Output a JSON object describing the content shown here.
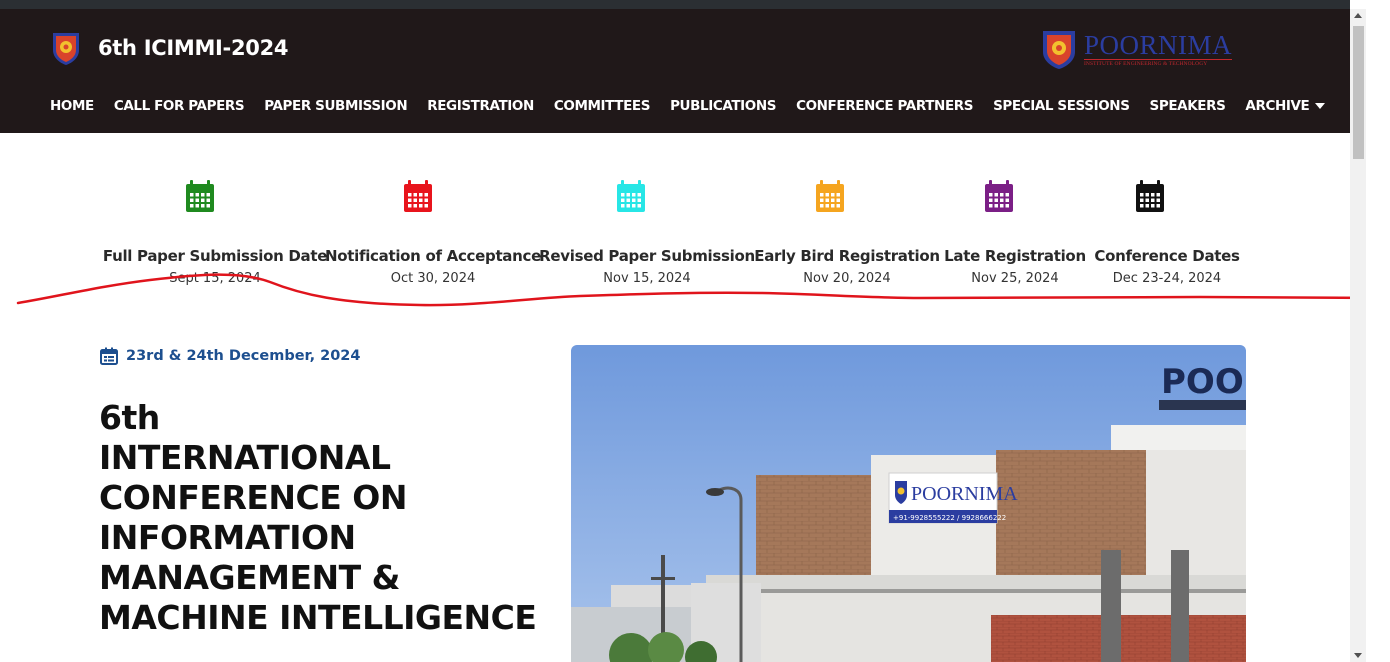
{
  "header": {
    "brand_title": "6th ICIMMI-2024",
    "partner_logo": {
      "name": "POORNIMA",
      "subtitle": "INSTITUTE OF ENGINEERING & TECHNOLOGY"
    },
    "nav": [
      {
        "label": "HOME"
      },
      {
        "label": "CALL FOR PAPERS"
      },
      {
        "label": "PAPER SUBMISSION"
      },
      {
        "label": "REGISTRATION"
      },
      {
        "label": "COMMITTEES"
      },
      {
        "label": "PUBLICATIONS"
      },
      {
        "label": "CONFERENCE PARTNERS"
      },
      {
        "label": "SPECIAL SESSIONS"
      },
      {
        "label": "SPEAKERS"
      },
      {
        "label": "ARCHIVE"
      }
    ]
  },
  "important_dates": [
    {
      "label": "Full Paper Submission Date",
      "date": "Sept 15, 2024",
      "icon": "calendar-icon",
      "color": "#1f8a1f"
    },
    {
      "label": "Notification of Acceptance",
      "date": "Oct 30, 2024",
      "icon": "calendar-icon",
      "color": "#e8141c"
    },
    {
      "label": "Revised Paper Submission",
      "date": "Nov 15, 2024",
      "icon": "calendar-icon",
      "color": "#27e6e6"
    },
    {
      "label": "Early Bird Registration",
      "date": "Nov 20, 2024",
      "icon": "calendar-icon",
      "color": "#f5a51f"
    },
    {
      "label": "Late Registration",
      "date": "Nov 25, 2024",
      "icon": "calendar-icon",
      "color": "#7b1f86"
    },
    {
      "label": "Conference Dates",
      "date": "Dec 23-24, 2024",
      "icon": "calendar-icon",
      "color": "#111111"
    }
  ],
  "hero": {
    "date": "23rd & 24th December, 2024",
    "title_lines": [
      "6th",
      "INTERNATIONAL",
      "CONFERENCE ON",
      "INFORMATION",
      "MANAGEMENT &",
      "MACHINE INTELLIGENCE"
    ],
    "photo": {
      "building_sign": "POORNIMA",
      "rooftop_sign": "POOR",
      "banner_text": "+91-9928555222 / 9928666222"
    }
  },
  "colors": {
    "header_bg": "#201819",
    "hero_date": "#1d4f8f",
    "annotation": "#e0141c"
  }
}
